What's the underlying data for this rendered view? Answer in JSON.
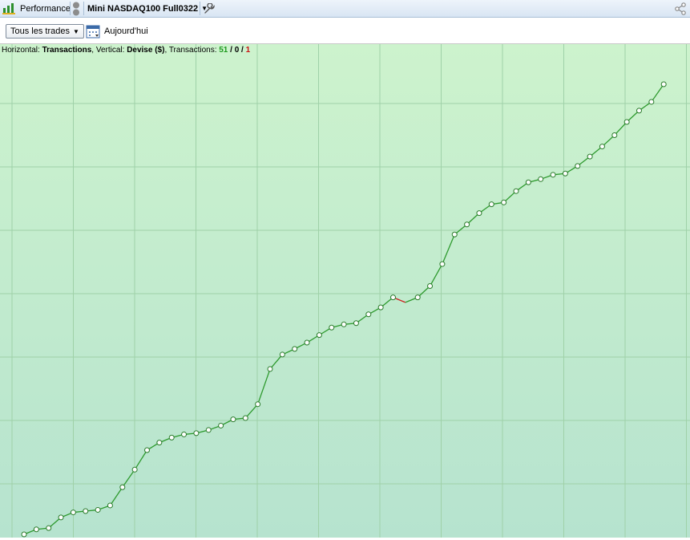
{
  "titlebar": {
    "tab_label": "Performance",
    "strategy_label": "Mini NASDAQ100 Full0322"
  },
  "toolbar": {
    "filter_label": "Tous les trades",
    "today_label": "Aujourd'hui"
  },
  "info": {
    "h_prefix": "Horizontal: ",
    "h_value": "Transactions",
    "v_prefix": ", Vertical: ",
    "v_value": "Devise ($)",
    "t_prefix": ", Transactions: ",
    "wins": "51",
    "slash1": " / ",
    "even": "0",
    "slash2": " / ",
    "losses": "1"
  },
  "colors": {
    "line_up": "#2e9a2e",
    "line_down": "#cc2222",
    "bg_top": "#cdf3cd",
    "bg_bottom": "#b6e3cf",
    "grid": "#9fd1a8"
  },
  "chart_data": {
    "type": "line",
    "title": "",
    "xlabel": "Transactions",
    "ylabel": "Devise ($)",
    "grid": true,
    "x_range": [
      0,
      56
    ],
    "y_range": [
      -0.05,
      7.7
    ],
    "series": [
      {
        "values": [
          0.0,
          0.08,
          0.1,
          0.27,
          0.35,
          0.37,
          0.39,
          0.46,
          0.75,
          1.03,
          1.34,
          1.46,
          1.54,
          1.59,
          1.61,
          1.66,
          1.73,
          1.83,
          1.85,
          2.07,
          2.63,
          2.86,
          2.95,
          3.05,
          3.17,
          3.29,
          3.34,
          3.36,
          3.5,
          3.61,
          3.77,
          3.69,
          3.77,
          3.95,
          4.3,
          4.77,
          4.93,
          5.11,
          5.25,
          5.28,
          5.46,
          5.6,
          5.65,
          5.72,
          5.74,
          5.86,
          6.01,
          6.17,
          6.35,
          6.56,
          6.74,
          6.88,
          7.16
        ]
      }
    ]
  }
}
